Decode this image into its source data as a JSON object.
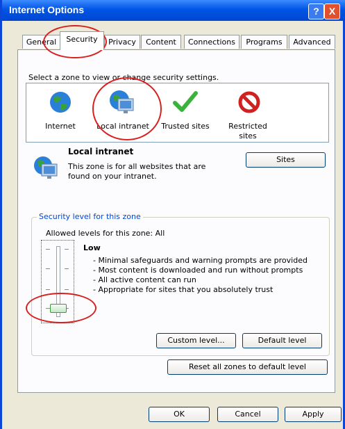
{
  "window": {
    "title": "Internet Options",
    "help_label": "?",
    "close_label": "X"
  },
  "tabs": [
    {
      "label": "General"
    },
    {
      "label": "Security"
    },
    {
      "label": "Privacy"
    },
    {
      "label": "Content"
    },
    {
      "label": "Connections"
    },
    {
      "label": "Programs"
    },
    {
      "label": "Advanced"
    }
  ],
  "security": {
    "select_text": "Select a zone to view or change security settings.",
    "zones": [
      {
        "label": "Internet",
        "icon": "globe-icon"
      },
      {
        "label": "Local intranet",
        "icon": "computer-globe-icon"
      },
      {
        "label": "Trusted sites",
        "icon": "checkmark-icon"
      },
      {
        "label": "Restricted sites",
        "icon": "prohibited-icon"
      }
    ],
    "selected_zone": {
      "title": "Local intranet",
      "description": "This zone is for all websites that are found on your intranet."
    },
    "sites_button": "Sites",
    "level_group_label": "Security level for this zone",
    "allowed_levels": "Allowed levels for this zone: All",
    "level_name": "Low",
    "level_bullets": [
      "- Minimal safeguards and warning prompts are provided",
      "- Most content is downloaded and run without prompts",
      "- All active content can run",
      "- Appropriate for sites that you absolutely trust"
    ],
    "custom_level_button": "Custom level...",
    "default_level_button": "Default level",
    "reset_all_button": "Reset all zones to default level"
  },
  "footer": {
    "ok": "OK",
    "cancel": "Cancel",
    "apply": "Apply"
  },
  "colors": {
    "title_bar": "#0055e5",
    "dialog_bg": "#ece9d8",
    "annotation": "#d8201e",
    "legend": "#0046d5"
  }
}
